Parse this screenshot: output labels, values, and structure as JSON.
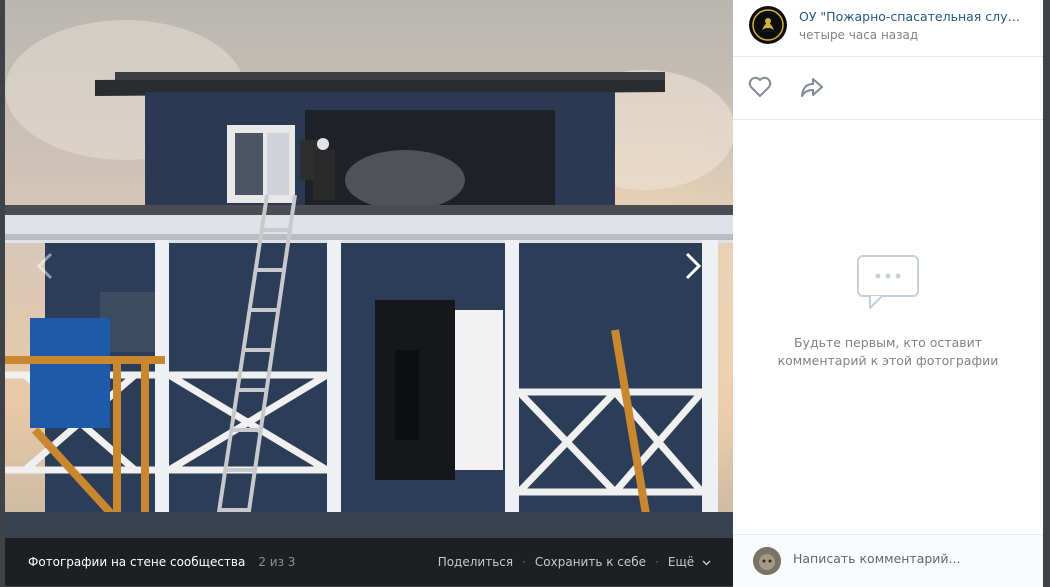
{
  "viewer": {
    "album_title": "Фотографии на стене сообщества",
    "counter": "2 из 3",
    "actions": {
      "share": "Поделиться",
      "save": "Сохранить к себе",
      "more": "Ещё"
    }
  },
  "post": {
    "group_name": "ОУ \"Пожарно-спасательная служб…",
    "time": "четыре часа назад"
  },
  "comments": {
    "empty_line1": "Будьте первым, кто оставит",
    "empty_line2": "комментарий к этой фотографии",
    "input_placeholder": "Написать комментарий..."
  },
  "colors": {
    "link": "#2a5885",
    "muted": "#828282",
    "viewer_bar": "#1e1f21"
  }
}
